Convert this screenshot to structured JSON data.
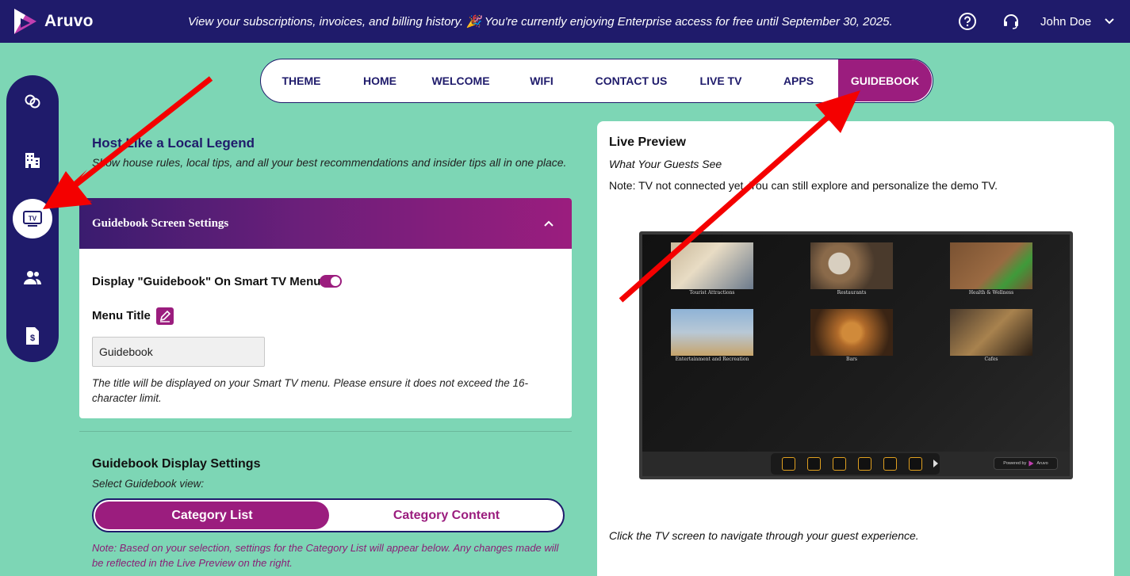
{
  "app": {
    "brand": "Aruvo"
  },
  "header": {
    "announcement": "View your subscriptions, invoices, and billing history. 🎉 You're currently enjoying Enterprise access for free until September 30, 2025.",
    "user_name": "John Doe"
  },
  "sidebar": {
    "items": [
      {
        "icon": "link-icon"
      },
      {
        "icon": "building-icon"
      },
      {
        "icon": "tv-icon",
        "label": "TV",
        "active": true
      },
      {
        "icon": "users-icon"
      },
      {
        "icon": "invoice-icon"
      }
    ]
  },
  "tabs": [
    {
      "label": "THEME"
    },
    {
      "label": "HOME"
    },
    {
      "label": "WELCOME"
    },
    {
      "label": "WIFI"
    },
    {
      "label": "CONTACT US"
    },
    {
      "label": "LIVE TV"
    },
    {
      "label": "APPS"
    },
    {
      "label": "GUIDEBOOK",
      "active": true
    }
  ],
  "intro": {
    "title": "Host Like a Local Legend",
    "subtitle": "Show house rules, local tips, and all your best recommendations and insider tips all in one place."
  },
  "screen_settings": {
    "title": "Guidebook Screen Settings",
    "display_label": "Display \"Guidebook\" On Smart TV Menu",
    "display_enabled": true,
    "menu_title_label": "Menu Title",
    "menu_title_value": "Guidebook",
    "help": "The title will be displayed on your Smart TV menu. Please ensure it does not exceed the 16-character limit."
  },
  "display_settings": {
    "title": "Guidebook Display Settings",
    "subtitle": "Select Guidebook view:",
    "options": [
      "Category List",
      "Category Content"
    ],
    "selected": "Category List",
    "note": "Note: Based on your selection, settings for the Category List will appear below. Any changes made will be reflected in the Live Preview on the right."
  },
  "preview": {
    "title": "Live Preview",
    "subtitle": "What Your Guests See",
    "note": "Note: TV not connected yet. You can still explore and personalize the demo TV.",
    "footer": "Click the TV screen to navigate through your guest experience.",
    "tiles": [
      {
        "caption": "Tourist Attractions",
        "color1": "#c9b89a",
        "color2": "#6b7a8c"
      },
      {
        "caption": "Restaurants",
        "color1": "#8a6a4a",
        "color2": "#d8cfc0"
      },
      {
        "caption": "Health & Wellness",
        "color1": "#7a5232",
        "color2": "#3f9a3a"
      },
      {
        "caption": "Entertainment and Recreation",
        "color1": "#8fb3d6",
        "color2": "#c7a46a"
      },
      {
        "caption": "Bars",
        "color1": "#b06a2a",
        "color2": "#3a2414"
      },
      {
        "caption": "Cafes",
        "color1": "#4a3a2c",
        "color2": "#a8824e"
      }
    ],
    "powered_by": "Powered by",
    "powered_brand": "Aruvo"
  },
  "colors": {
    "navy": "#1f1b6b",
    "magenta": "#9b1d7e",
    "mint": "#7dd6b5"
  }
}
